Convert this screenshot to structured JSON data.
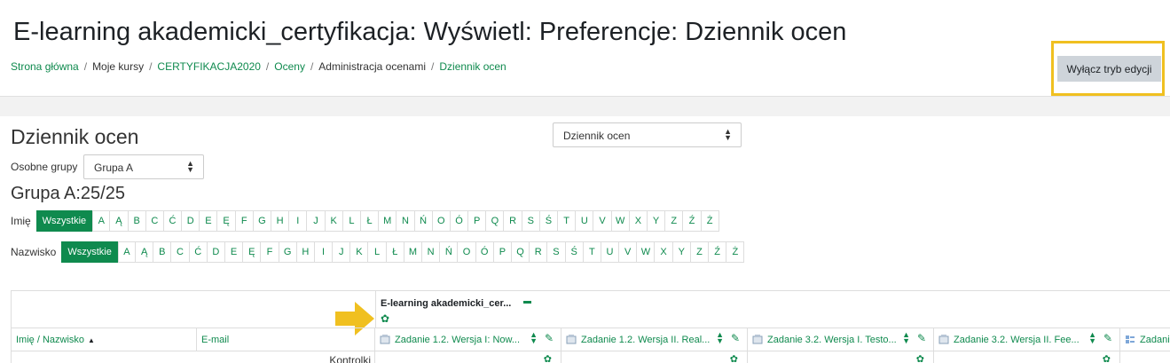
{
  "page": {
    "title": "E-learning akademicki_certyfikacja: Wyświetl: Preferencje: Dziennik ocen"
  },
  "breadcrumb": [
    {
      "label": "Strona główna",
      "link": true
    },
    {
      "label": "Moje kursy",
      "link": false
    },
    {
      "label": "CERTYFIKACJA2020",
      "link": true
    },
    {
      "label": "Oceny",
      "link": true
    },
    {
      "label": "Administracja ocenami",
      "link": false
    },
    {
      "label": "Dziennik ocen",
      "link": true
    }
  ],
  "edit_button": {
    "label": "Wyłącz tryb edycji"
  },
  "report": {
    "title": "Dziennik ocen",
    "select_value": "Dziennik ocen"
  },
  "groups": {
    "label": "Osobne grupy",
    "select_value": "Grupa A",
    "count_label": "Grupa A:25/25"
  },
  "firstname_filter": {
    "label": "Imię",
    "all": "Wszystkie",
    "letters": [
      "A",
      "Ą",
      "B",
      "C",
      "Ć",
      "D",
      "E",
      "Ę",
      "F",
      "G",
      "H",
      "I",
      "J",
      "K",
      "L",
      "Ł",
      "M",
      "N",
      "Ń",
      "O",
      "Ó",
      "P",
      "Q",
      "R",
      "S",
      "Ś",
      "T",
      "U",
      "V",
      "W",
      "X",
      "Y",
      "Z",
      "Ź",
      "Ż"
    ]
  },
  "lastname_filter": {
    "label": "Nazwisko",
    "all": "Wszystkie",
    "letters": [
      "A",
      "Ą",
      "B",
      "C",
      "Ć",
      "D",
      "E",
      "Ę",
      "F",
      "G",
      "H",
      "I",
      "J",
      "K",
      "L",
      "Ł",
      "M",
      "N",
      "Ń",
      "O",
      "Ó",
      "P",
      "Q",
      "R",
      "S",
      "Ś",
      "T",
      "U",
      "V",
      "W",
      "X",
      "Y",
      "Z",
      "Ź",
      "Ż"
    ]
  },
  "table": {
    "course_name": "E-learning akademicki_cer...",
    "columns": {
      "name_header": "Imię / Nazwisko",
      "email_header": "E-mail",
      "items": [
        "Zadanie 1.2. Wersja I: Now...",
        "Zadanie 1.2. Wersja II. Real...",
        "Zadanie 3.2. Wersja I. Testo...",
        "Zadanie 3.2. Wersja II. Fee...",
        "Zadani"
      ]
    },
    "controls_label": "Kontrolki"
  },
  "colors": {
    "accent": "#0f8a4e",
    "highlight": "#f0c020"
  }
}
